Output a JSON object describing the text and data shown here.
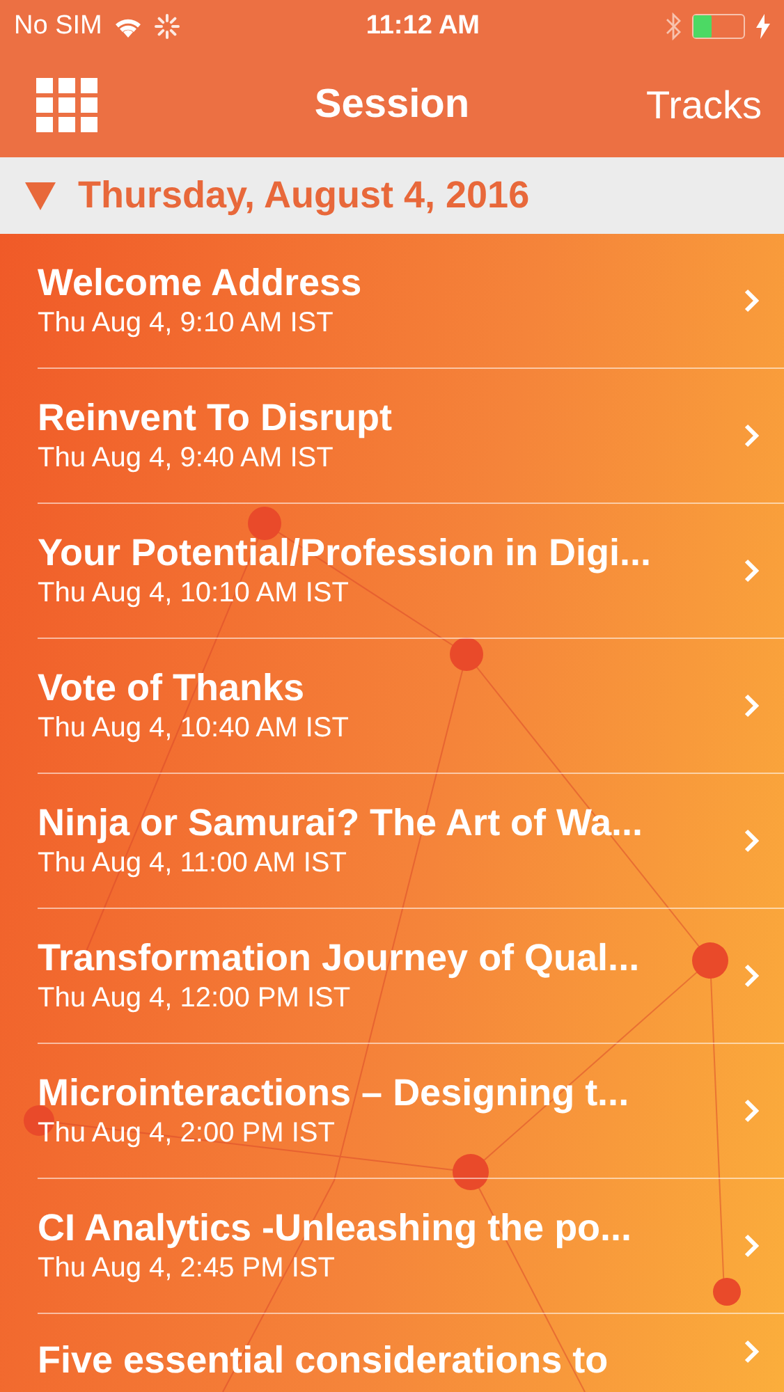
{
  "status_bar": {
    "carrier": "No SIM",
    "time": "11:12 AM",
    "battery": {
      "level": 0.35,
      "charging": true
    }
  },
  "nav": {
    "title": "Session",
    "right_button": "Tracks"
  },
  "section": {
    "title": "Thursday, August 4, 2016",
    "expanded": true
  },
  "sessions": [
    {
      "title": "Welcome Address",
      "time": "Thu Aug 4, 9:10 AM IST"
    },
    {
      "title": "Reinvent To Disrupt",
      "time": "Thu Aug 4, 9:40 AM IST"
    },
    {
      "title": "Your Potential/Profession in Digi...",
      "time": "Thu Aug 4, 10:10 AM IST"
    },
    {
      "title": "Vote of Thanks",
      "time": "Thu Aug 4, 10:40 AM IST"
    },
    {
      "title": "Ninja or Samurai? The Art of Wa...",
      "time": "Thu Aug 4, 11:00 AM IST"
    },
    {
      "title": "Transformation Journey of Qual...",
      "time": "Thu Aug 4, 12:00 PM IST"
    },
    {
      "title": "Microinteractions – Designing t...",
      "time": "Thu Aug 4, 2:00 PM IST"
    },
    {
      "title": "CI Analytics -Unleashing the po...",
      "time": "Thu Aug 4, 2:45 PM IST"
    },
    {
      "title": "Five essential considerations to"
    }
  ]
}
